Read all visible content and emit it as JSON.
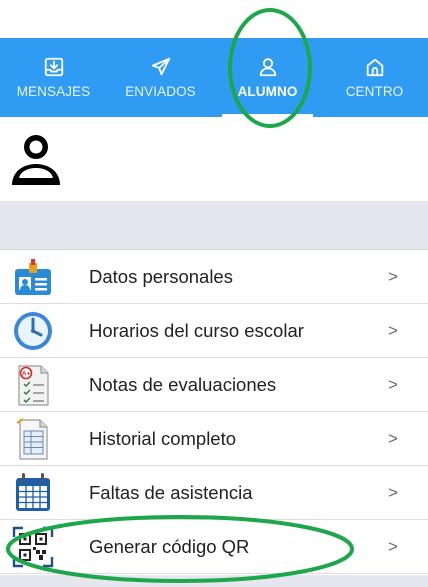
{
  "tabs": [
    {
      "label": "MENSAJES",
      "icon": "inbox-download-icon",
      "active": false
    },
    {
      "label": "ENVIADOS",
      "icon": "paper-plane-icon",
      "active": false
    },
    {
      "label": "ALUMNO",
      "icon": "user-icon",
      "active": true
    },
    {
      "label": "CENTRO",
      "icon": "home-icon",
      "active": false
    }
  ],
  "menu": [
    {
      "label": "Datos personales",
      "chevron": ">",
      "icon": "id-card-icon"
    },
    {
      "label": "Horarios del curso escolar",
      "chevron": ">",
      "icon": "clock-icon"
    },
    {
      "label": "Notas de evaluaciones",
      "chevron": ">",
      "icon": "graded-document-icon"
    },
    {
      "label": "Historial completo",
      "chevron": ">",
      "icon": "document-history-icon"
    },
    {
      "label": "Faltas de asistencia",
      "chevron": ">",
      "icon": "calendar-icon"
    },
    {
      "label": "Generar código QR",
      "chevron": ">",
      "icon": "qr-code-icon"
    }
  ],
  "colors": {
    "tabbar": "#2f9bf3",
    "annotation": "#1ea64a",
    "greyband": "#e6e6ee"
  }
}
